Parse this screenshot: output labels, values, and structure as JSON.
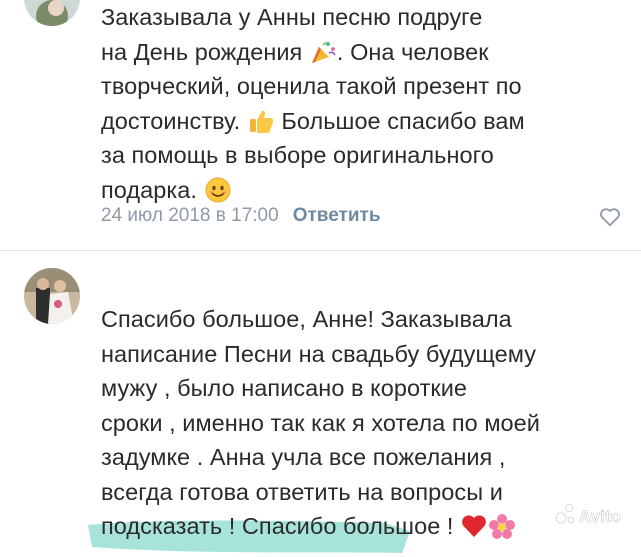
{
  "comments": [
    {
      "text_lines": [
        "Заказывала у Анны песню подруге",
        "на День рождения",
        ". Она человек",
        "творческий, оценила такой презент по",
        "достоинству.",
        "Большое спасибо вам",
        "за помощь в выборе оригинального",
        "подарка."
      ],
      "emojis": [
        "party-popper",
        "thumbs-up",
        "smiley"
      ],
      "date": "24 июл 2018 в 17:00",
      "reply_label": "Ответить",
      "like_icon": "heart-outline-icon"
    },
    {
      "text_lines": [
        "Спасибо большое, Анне! Заказывала",
        "написание Песни на свадьбу будущему",
        "мужу , было написано в короткие",
        "сроки , именно так как я хотела по моей",
        "задумке . Анна учла все пожелания ,",
        "всегда готова ответить на вопросы и",
        "подсказать ! Спасибо большое !"
      ],
      "emojis": [
        "red-heart",
        "flower"
      ]
    }
  ],
  "watermark": "Avito",
  "colors": {
    "text": "#2b2b2b",
    "date": "#8e9aa8",
    "reply": "#6f89a3",
    "divider": "#e1e5ea",
    "redaction": "#a8e3d9"
  }
}
